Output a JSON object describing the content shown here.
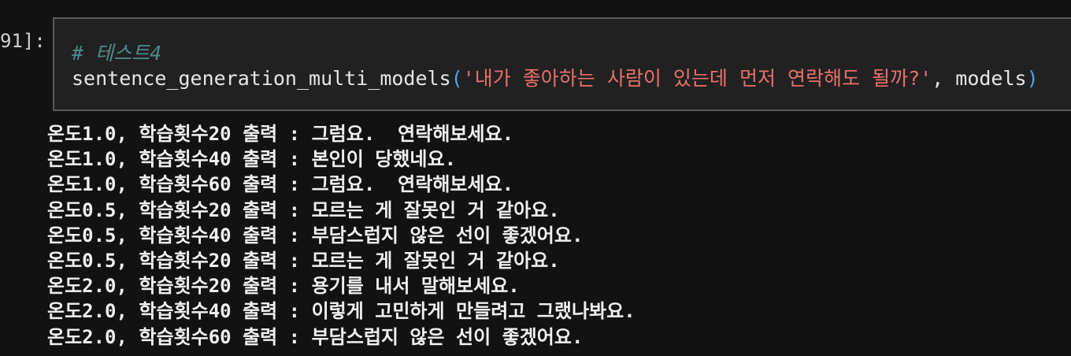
{
  "cell": {
    "prompt": "91]:",
    "comment": "# 테스트4",
    "function_name": "sentence_generation_multi_models",
    "open_paren": "(",
    "string_arg": "'내가 좋아하는 사람이 있는데 먼저 연락해도 될까?'",
    "separator": ", ",
    "second_arg": "models",
    "close_paren": ")"
  },
  "output": {
    "lines": [
      "온도1.0, 학습횟수20 출력 : 그럼요.  연락해보세요.",
      "온도1.0, 학습횟수40 출력 : 본인이 당했네요.",
      "온도1.0, 학습횟수60 출력 : 그럼요.  연락해보세요.",
      "온도0.5, 학습횟수20 출력 : 모르는 게 잘못인 거 같아요.",
      "온도0.5, 학습횟수40 출력 : 부담스럽지 않은 선이 좋겠어요.",
      "온도0.5, 학습횟수20 출력 : 모르는 게 잘못인 거 같아요.",
      "온도2.0, 학습횟수20 출력 : 용기를 내서 말해보세요.",
      "온도2.0, 학습횟수40 출력 : 이렇게 고민하게 만들려고 그랬나봐요.",
      "온도2.0, 학습횟수60 출력 : 부담스럽지 않은 선이 좋겠어요."
    ]
  },
  "colors": {
    "background": "#121212",
    "cell_background": "#212121",
    "comment": "#4f8a8b",
    "string": "#e8706a",
    "paren": "#4aa3f0"
  }
}
